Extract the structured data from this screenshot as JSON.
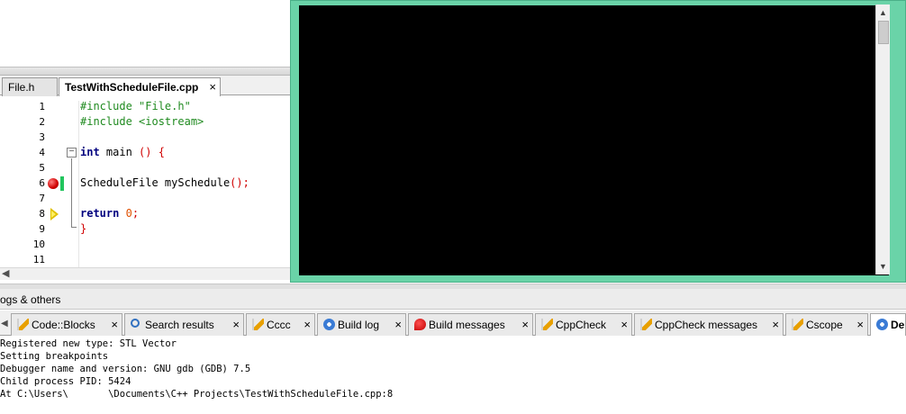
{
  "editor": {
    "tabs": [
      {
        "label": "File.h",
        "close": ""
      },
      {
        "label": "TestWithScheduleFile.cpp",
        "close": "×"
      }
    ],
    "line_numbers": [
      "1",
      "2",
      "3",
      "4",
      "5",
      "6",
      "7",
      "8",
      "9",
      "10",
      "11"
    ],
    "code": {
      "l1": "#include \"File.h\"",
      "l2": "#include <iostream>",
      "l4_kw": "int",
      "l4_rest": " main ",
      "l4_paren": "() {",
      "l6_text": "ScheduleFile mySchedule",
      "l6_paren": "();",
      "l8_kw": "return",
      "l8_num": "0",
      "l8_semi": ";",
      "l9": "}"
    },
    "fold_symbol": "−"
  },
  "logs": {
    "title": "ogs & others",
    "tabs": [
      {
        "label": "Code::Blocks",
        "icon": "pencil-icon",
        "close": "×"
      },
      {
        "label": "Search results",
        "icon": "magnifier-icon",
        "close": "×"
      },
      {
        "label": "Cccc",
        "icon": "pencil-icon",
        "close": "×"
      },
      {
        "label": "Build log",
        "icon": "gear-icon",
        "close": "×"
      },
      {
        "label": "Build messages",
        "icon": "pin-icon",
        "close": "×"
      },
      {
        "label": "CppCheck",
        "icon": "pencil-icon",
        "close": "×"
      },
      {
        "label": "CppCheck messages",
        "icon": "pencil-icon",
        "close": "×"
      },
      {
        "label": "Cscope",
        "icon": "pencil-icon",
        "close": "×"
      },
      {
        "label": "De",
        "icon": "gear-icon",
        "close": ""
      }
    ],
    "output": [
      "Registered new type: STL Vector",
      "Setting breakpoints",
      "Debugger name and version: GNU gdb (GDB) 7.5",
      "Child process PID: 5424",
      "At C:\\Users\\       \\Documents\\C++ Projects\\TestWithScheduleFile.cpp:8"
    ]
  },
  "colors": {
    "console_frame": "#6ad3a8",
    "console_bg": "#000000",
    "preprocessor": "#1f8a1f",
    "keyword": "#00007f",
    "breakpoint": "#d00000",
    "changebar": "#22c55e"
  }
}
